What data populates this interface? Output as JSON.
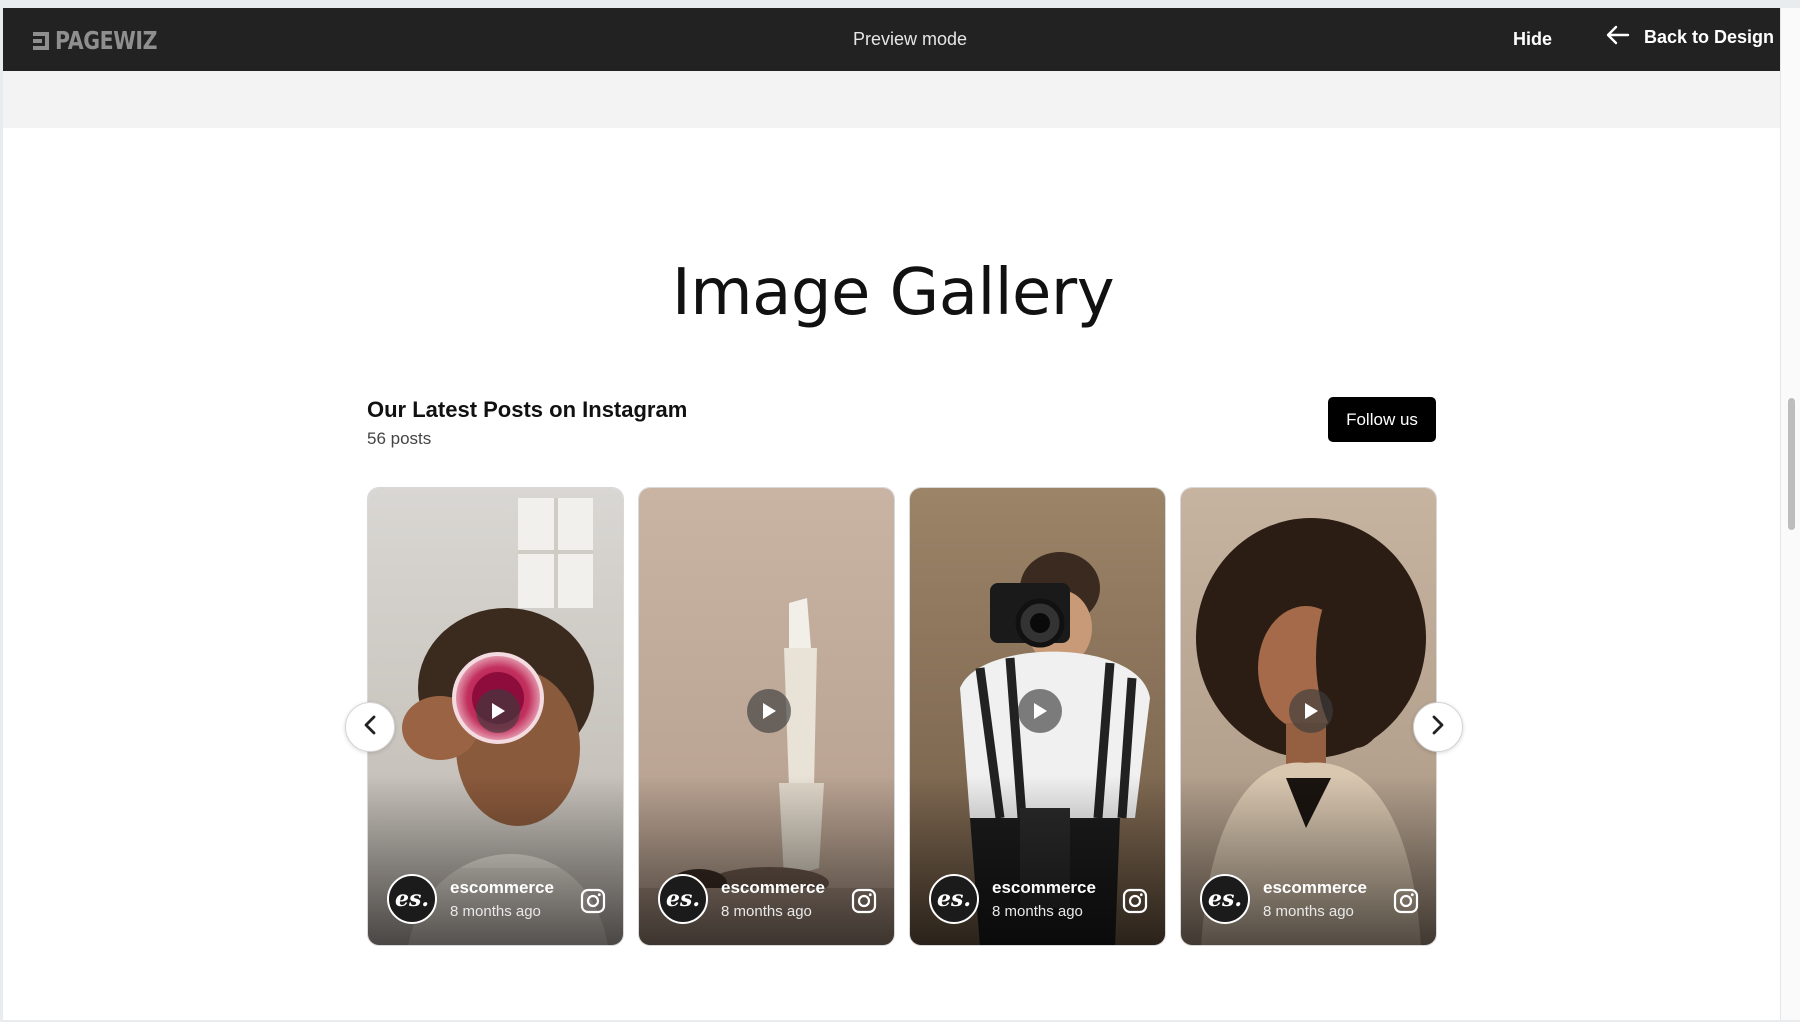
{
  "topbar": {
    "logo_text": "PAGEWIZ",
    "mode_label": "Preview mode",
    "hide_label": "Hide",
    "back_label": "Back to Design",
    "background": "#222222"
  },
  "gallery": {
    "title": "Image Gallery"
  },
  "instagram": {
    "heading": "Our Latest Posts on Instagram",
    "post_count": "56 posts",
    "follow_label": "Follow us",
    "posts": [
      {
        "avatar_text": "es.",
        "username": "escommerce",
        "time": "8 months ago",
        "icon": "instagram-icon",
        "play_icon": "play-icon"
      },
      {
        "avatar_text": "es.",
        "username": "escommerce",
        "time": "8 months ago",
        "icon": "instagram-icon",
        "play_icon": "play-icon"
      },
      {
        "avatar_text": "es.",
        "username": "escommerce",
        "time": "8 months ago",
        "icon": "instagram-icon",
        "play_icon": "play-icon"
      },
      {
        "avatar_text": "es.",
        "username": "escommerce",
        "time": "8 months ago",
        "icon": "instagram-icon",
        "play_icon": "play-icon"
      }
    ]
  },
  "carousel": {
    "prev_icon": "chevron-left-icon",
    "next_icon": "chevron-right-icon"
  }
}
